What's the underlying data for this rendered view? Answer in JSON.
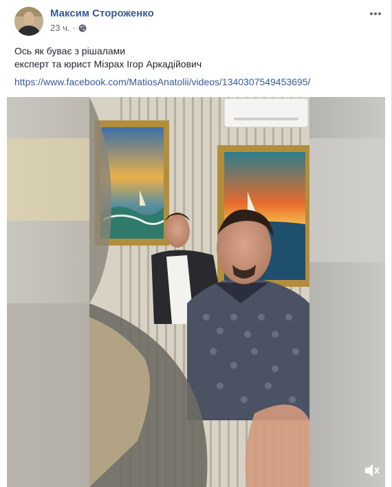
{
  "post": {
    "author": "Максим Стороженко",
    "timestamp": "23 ч.",
    "separator": "·",
    "privacy_icon": "globe-icon",
    "text_lines": [
      "Ось як буває з рішалами",
      "експерт та юрист Мізрах Ігор Аркадійович"
    ],
    "link": "https://www.facebook.com/MatiosAnatolii/videos/1340307549453695/",
    "more_icon": "ellipsis-icon"
  },
  "video": {
    "mute_icon": "volume-muted-icon"
  },
  "colors": {
    "link": "#385898",
    "text": "#1d2129",
    "secondary": "#616770"
  }
}
